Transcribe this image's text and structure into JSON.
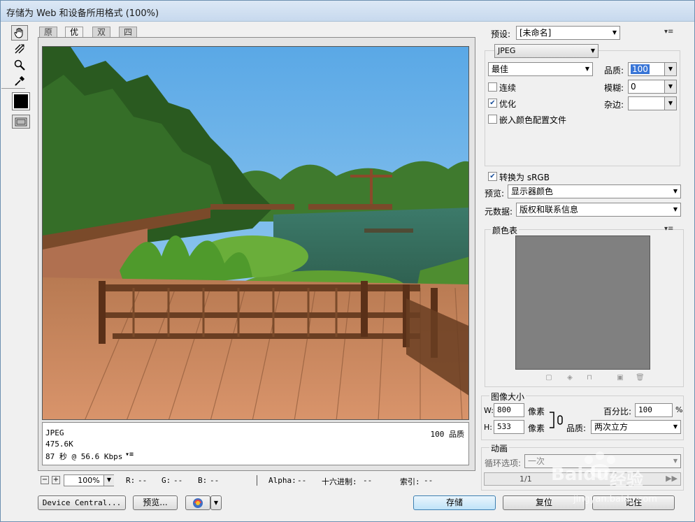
{
  "window": {
    "title": "存储为 Web 和设备所用格式 (100%)"
  },
  "tools": [
    {
      "name": "hand-tool",
      "icon": "hand-icon"
    },
    {
      "name": "slice-select-tool",
      "icon": "slice-select-icon"
    },
    {
      "name": "zoom-tool",
      "icon": "magnifier-icon"
    },
    {
      "name": "eyedropper-tool",
      "icon": "eyedropper-icon"
    }
  ],
  "tabs": [
    "原稿",
    "优化",
    "双联",
    "四联"
  ],
  "active_tab": "优化",
  "info": {
    "format": "JPEG",
    "size": "475.6K",
    "time": "87 秒 @ 56.6 Kbps",
    "quality": "100 品质"
  },
  "status": {
    "zoom": "100%",
    "r_label": "R:",
    "r_value": "--",
    "g_label": "G:",
    "g_value": "--",
    "b_label": "B:",
    "b_value": "--",
    "alpha_label": "Alpha:",
    "alpha_value": "--",
    "hex_label": "十六进制:",
    "hex_value": "--",
    "index_label": "索引:",
    "index_value": "--"
  },
  "bottom_buttons": {
    "device_central": "Device Central...",
    "preview": "预览...",
    "save": "存储",
    "reset": "复位",
    "remember": "记住"
  },
  "settings": {
    "preset_label": "预设:",
    "preset_value": "[未命名]",
    "format_value": "JPEG",
    "quality_preset": "最佳",
    "quality_label": "品质:",
    "quality_value": "100",
    "progressive_label": "连续",
    "progressive_checked": false,
    "blur_label": "模糊:",
    "blur_value": "0",
    "optimized_label": "优化",
    "optimized_checked": true,
    "matte_label": "杂边:",
    "matte_value": "",
    "embed_profile_label": "嵌入颜色配置文件",
    "embed_profile_checked": false,
    "convert_srgb_label": "转换为 sRGB",
    "convert_srgb_checked": true,
    "preview_label": "预览:",
    "preview_value": "显示器颜色",
    "metadata_label": "元数据:",
    "metadata_value": "版权和联系信息"
  },
  "color_table": {
    "title": "颜色表",
    "fill": "#808080"
  },
  "image_size": {
    "title": "图像大小",
    "w_label": "W:",
    "w_value": "800",
    "w_unit": "像素",
    "h_label": "H:",
    "h_value": "533",
    "h_unit": "像素",
    "percent_label": "百分比:",
    "percent_value": "100",
    "percent_unit": "%",
    "quality_label": "品质:",
    "quality_value": "两次立方"
  },
  "animation": {
    "title": "动画",
    "loop_label": "循环选项:",
    "loop_value": "一次",
    "frame_counter": "1/1"
  },
  "watermark": {
    "brand": "Baidu",
    "brand_cn": "经验",
    "url": "jingyan.baidu.com"
  },
  "colors": {
    "accent": "#3399ff",
    "selection": "#3875d7"
  }
}
